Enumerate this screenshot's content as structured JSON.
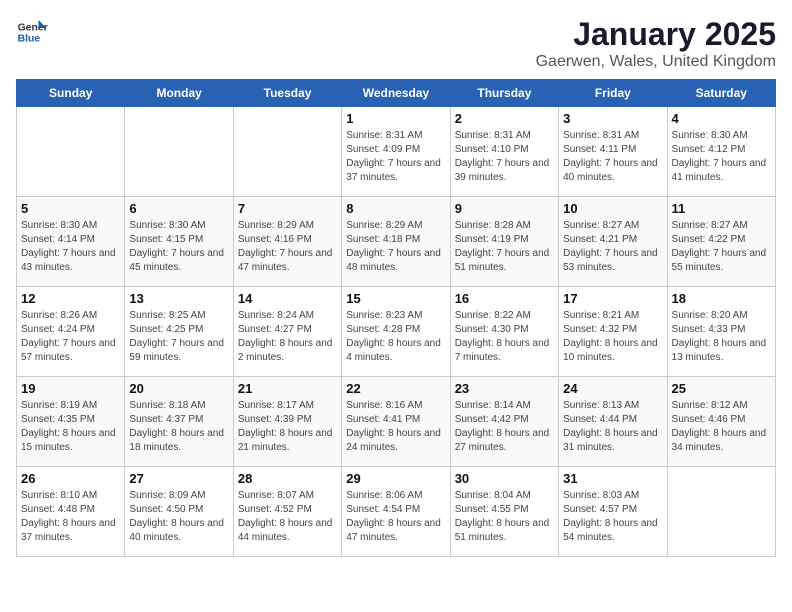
{
  "logo": {
    "general": "General",
    "blue": "Blue"
  },
  "title": "January 2025",
  "subtitle": "Gaerwen, Wales, United Kingdom",
  "days_of_week": [
    "Sunday",
    "Monday",
    "Tuesday",
    "Wednesday",
    "Thursday",
    "Friday",
    "Saturday"
  ],
  "weeks": [
    [
      {
        "day": "",
        "info": ""
      },
      {
        "day": "",
        "info": ""
      },
      {
        "day": "",
        "info": ""
      },
      {
        "day": "1",
        "info": "Sunrise: 8:31 AM\nSunset: 4:09 PM\nDaylight: 7 hours and 37 minutes."
      },
      {
        "day": "2",
        "info": "Sunrise: 8:31 AM\nSunset: 4:10 PM\nDaylight: 7 hours and 39 minutes."
      },
      {
        "day": "3",
        "info": "Sunrise: 8:31 AM\nSunset: 4:11 PM\nDaylight: 7 hours and 40 minutes."
      },
      {
        "day": "4",
        "info": "Sunrise: 8:30 AM\nSunset: 4:12 PM\nDaylight: 7 hours and 41 minutes."
      }
    ],
    [
      {
        "day": "5",
        "info": "Sunrise: 8:30 AM\nSunset: 4:14 PM\nDaylight: 7 hours and 43 minutes."
      },
      {
        "day": "6",
        "info": "Sunrise: 8:30 AM\nSunset: 4:15 PM\nDaylight: 7 hours and 45 minutes."
      },
      {
        "day": "7",
        "info": "Sunrise: 8:29 AM\nSunset: 4:16 PM\nDaylight: 7 hours and 47 minutes."
      },
      {
        "day": "8",
        "info": "Sunrise: 8:29 AM\nSunset: 4:18 PM\nDaylight: 7 hours and 48 minutes."
      },
      {
        "day": "9",
        "info": "Sunrise: 8:28 AM\nSunset: 4:19 PM\nDaylight: 7 hours and 51 minutes."
      },
      {
        "day": "10",
        "info": "Sunrise: 8:27 AM\nSunset: 4:21 PM\nDaylight: 7 hours and 53 minutes."
      },
      {
        "day": "11",
        "info": "Sunrise: 8:27 AM\nSunset: 4:22 PM\nDaylight: 7 hours and 55 minutes."
      }
    ],
    [
      {
        "day": "12",
        "info": "Sunrise: 8:26 AM\nSunset: 4:24 PM\nDaylight: 7 hours and 57 minutes."
      },
      {
        "day": "13",
        "info": "Sunrise: 8:25 AM\nSunset: 4:25 PM\nDaylight: 7 hours and 59 minutes."
      },
      {
        "day": "14",
        "info": "Sunrise: 8:24 AM\nSunset: 4:27 PM\nDaylight: 8 hours and 2 minutes."
      },
      {
        "day": "15",
        "info": "Sunrise: 8:23 AM\nSunset: 4:28 PM\nDaylight: 8 hours and 4 minutes."
      },
      {
        "day": "16",
        "info": "Sunrise: 8:22 AM\nSunset: 4:30 PM\nDaylight: 8 hours and 7 minutes."
      },
      {
        "day": "17",
        "info": "Sunrise: 8:21 AM\nSunset: 4:32 PM\nDaylight: 8 hours and 10 minutes."
      },
      {
        "day": "18",
        "info": "Sunrise: 8:20 AM\nSunset: 4:33 PM\nDaylight: 8 hours and 13 minutes."
      }
    ],
    [
      {
        "day": "19",
        "info": "Sunrise: 8:19 AM\nSunset: 4:35 PM\nDaylight: 8 hours and 15 minutes."
      },
      {
        "day": "20",
        "info": "Sunrise: 8:18 AM\nSunset: 4:37 PM\nDaylight: 8 hours and 18 minutes."
      },
      {
        "day": "21",
        "info": "Sunrise: 8:17 AM\nSunset: 4:39 PM\nDaylight: 8 hours and 21 minutes."
      },
      {
        "day": "22",
        "info": "Sunrise: 8:16 AM\nSunset: 4:41 PM\nDaylight: 8 hours and 24 minutes."
      },
      {
        "day": "23",
        "info": "Sunrise: 8:14 AM\nSunset: 4:42 PM\nDaylight: 8 hours and 27 minutes."
      },
      {
        "day": "24",
        "info": "Sunrise: 8:13 AM\nSunset: 4:44 PM\nDaylight: 8 hours and 31 minutes."
      },
      {
        "day": "25",
        "info": "Sunrise: 8:12 AM\nSunset: 4:46 PM\nDaylight: 8 hours and 34 minutes."
      }
    ],
    [
      {
        "day": "26",
        "info": "Sunrise: 8:10 AM\nSunset: 4:48 PM\nDaylight: 8 hours and 37 minutes."
      },
      {
        "day": "27",
        "info": "Sunrise: 8:09 AM\nSunset: 4:50 PM\nDaylight: 8 hours and 40 minutes."
      },
      {
        "day": "28",
        "info": "Sunrise: 8:07 AM\nSunset: 4:52 PM\nDaylight: 8 hours and 44 minutes."
      },
      {
        "day": "29",
        "info": "Sunrise: 8:06 AM\nSunset: 4:54 PM\nDaylight: 8 hours and 47 minutes."
      },
      {
        "day": "30",
        "info": "Sunrise: 8:04 AM\nSunset: 4:55 PM\nDaylight: 8 hours and 51 minutes."
      },
      {
        "day": "31",
        "info": "Sunrise: 8:03 AM\nSunset: 4:57 PM\nDaylight: 8 hours and 54 minutes."
      },
      {
        "day": "",
        "info": ""
      }
    ]
  ]
}
